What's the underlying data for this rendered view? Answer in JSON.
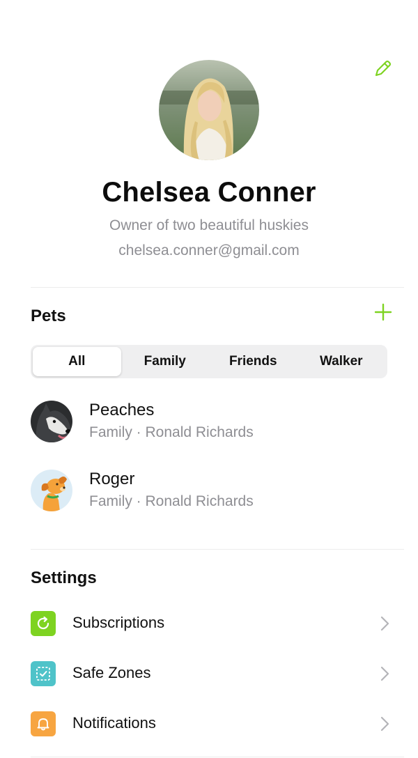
{
  "profile": {
    "name": "Chelsea Conner",
    "bio": "Owner of two beautiful huskies",
    "email": "chelsea.conner@gmail.com"
  },
  "pets": {
    "title": "Pets",
    "filters": [
      "All",
      "Family",
      "Friends",
      "Walker"
    ],
    "selected_filter": "All",
    "items": [
      {
        "name": "Peaches",
        "subtitle": "Family · Ronald Richards",
        "avatar": "husky-photo"
      },
      {
        "name": "Roger",
        "subtitle": "Family · Ronald Richards",
        "avatar": "cartoon-dog"
      }
    ]
  },
  "settings": {
    "title": "Settings",
    "items": [
      {
        "label": "Subscriptions",
        "icon": "refresh-icon",
        "color": "#7ed321"
      },
      {
        "label": "Safe Zones",
        "icon": "zone-check-icon",
        "color": "#4fc3c9"
      },
      {
        "label": "Notifications",
        "icon": "bell-icon",
        "color": "#f7a541"
      }
    ]
  },
  "colors": {
    "accent": "#7ed321",
    "secondary_text": "#8e8e93"
  }
}
